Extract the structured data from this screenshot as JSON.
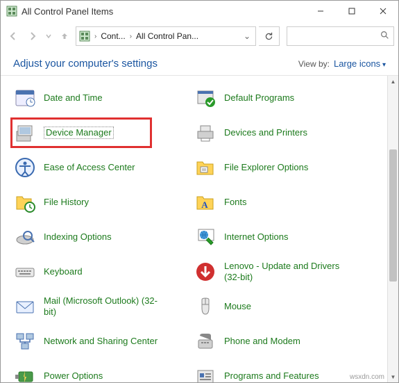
{
  "window": {
    "title": "All Control Panel Items"
  },
  "nav": {
    "crumb1": "Cont...",
    "crumb2": "All Control Pan...",
    "search_placeholder": ""
  },
  "header": {
    "adjust": "Adjust your computer's settings",
    "viewby_label": "View by:",
    "viewby_value": "Large icons"
  },
  "items_left": [
    {
      "label": "Date and Time",
      "icon": "date-time"
    },
    {
      "label": "Device Manager",
      "icon": "device-manager",
      "highlighted": true
    },
    {
      "label": "Ease of Access Center",
      "icon": "ease-access"
    },
    {
      "label": "File History",
      "icon": "file-history"
    },
    {
      "label": "Indexing Options",
      "icon": "indexing"
    },
    {
      "label": "Keyboard",
      "icon": "keyboard"
    },
    {
      "label": "Mail (Microsoft Outlook) (32-bit)",
      "icon": "mail"
    },
    {
      "label": "Network and Sharing Center",
      "icon": "network"
    },
    {
      "label": "Power Options",
      "icon": "power"
    }
  ],
  "items_right": [
    {
      "label": "Default Programs",
      "icon": "default-programs"
    },
    {
      "label": "Devices and Printers",
      "icon": "devices-printers"
    },
    {
      "label": "File Explorer Options",
      "icon": "file-explorer"
    },
    {
      "label": "Fonts",
      "icon": "fonts"
    },
    {
      "label": "Internet Options",
      "icon": "internet"
    },
    {
      "label": "Lenovo - Update and Drivers (32-bit)",
      "icon": "lenovo"
    },
    {
      "label": "Mouse",
      "icon": "mouse"
    },
    {
      "label": "Phone and Modem",
      "icon": "phone"
    },
    {
      "label": "Programs and Features",
      "icon": "programs"
    }
  ],
  "watermark": "wsxdn.com"
}
